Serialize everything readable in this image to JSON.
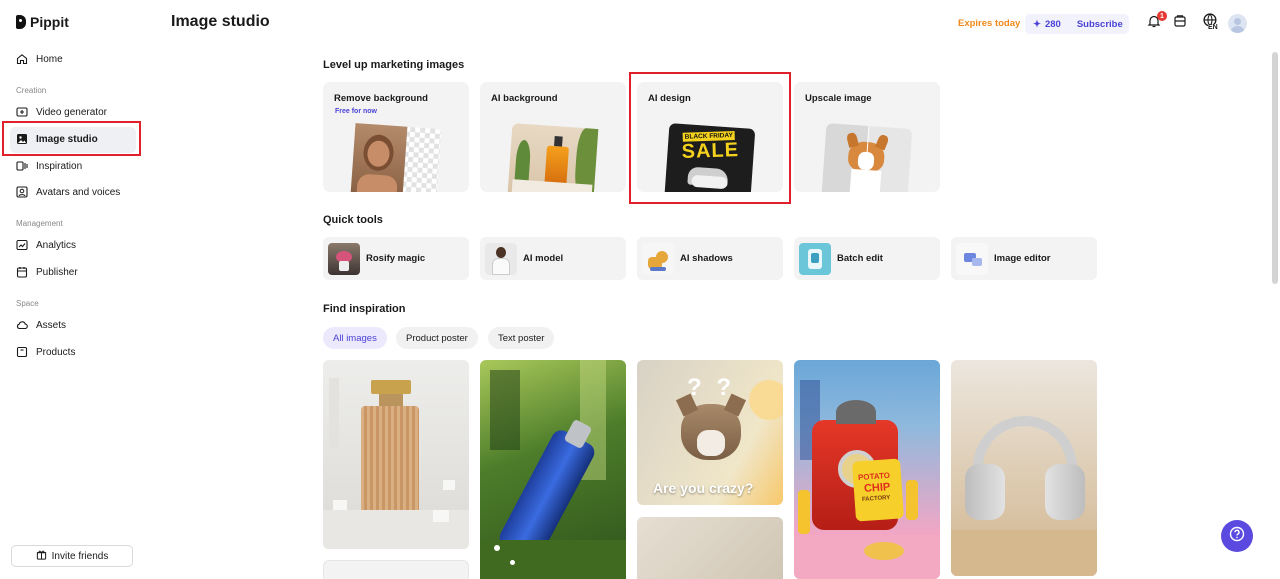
{
  "app": {
    "name": "Pippit"
  },
  "sidebar": {
    "home": "Home",
    "sections": {
      "creation": "Creation",
      "management": "Management",
      "space": "Space"
    },
    "items": {
      "video_generator": "Video generator",
      "image_studio": "Image studio",
      "inspiration": "Inspiration",
      "avatars": "Avatars and voices",
      "analytics": "Analytics",
      "publisher": "Publisher",
      "assets": "Assets",
      "products": "Products"
    },
    "invite": "Invite friends"
  },
  "header": {
    "title": "Image studio",
    "expires": "Expires today",
    "credits": "280",
    "subscribe": "Subscribe",
    "notification_count": "1",
    "language": "EN"
  },
  "marketing": {
    "title": "Level up marketing images",
    "cards": [
      {
        "label": "Remove background",
        "sub": "Free for now"
      },
      {
        "label": "AI background"
      },
      {
        "label": "AI design",
        "thumb_text_1": "BLACK FRIDAY",
        "thumb_text_2": "SALE"
      },
      {
        "label": "Upscale image"
      }
    ]
  },
  "quick_tools": {
    "title": "Quick tools",
    "items": [
      "Rosify magic",
      "AI model",
      "AI shadows",
      "Batch edit",
      "Image editor"
    ]
  },
  "inspiration": {
    "title": "Find inspiration",
    "filters": [
      "All images",
      "Product poster",
      "Text poster"
    ],
    "active_filter": "All images",
    "cat_caption": "Are you crazy?",
    "cat_marks": "? ?",
    "chips_text_1": "POTATO",
    "chips_text_2": "CHIP",
    "chips_text_3": "FACTORY"
  },
  "colors": {
    "accent": "#4b43d6",
    "expires": "#f08a1c",
    "highlight": "#e0202a"
  }
}
